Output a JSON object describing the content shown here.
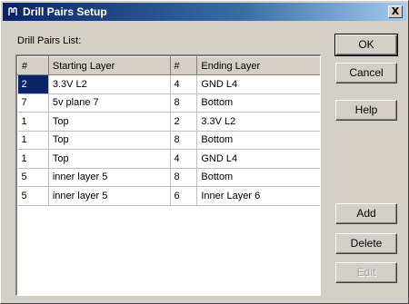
{
  "window": {
    "title": "Drill Pairs Setup",
    "close_label": "X"
  },
  "list": {
    "label": "Drill Pairs List:",
    "columns": [
      "#",
      "Starting Layer",
      "#",
      "Ending Layer"
    ],
    "rows": [
      {
        "start_num": "2",
        "start_layer": "3.3V L2",
        "end_num": "4",
        "end_layer": "GND L4",
        "selected": true
      },
      {
        "start_num": "7",
        "start_layer": "5v plane 7",
        "end_num": "8",
        "end_layer": "Bottom",
        "selected": false
      },
      {
        "start_num": "1",
        "start_layer": "Top",
        "end_num": "2",
        "end_layer": "3.3V L2",
        "selected": false
      },
      {
        "start_num": "1",
        "start_layer": "Top",
        "end_num": "8",
        "end_layer": "Bottom",
        "selected": false
      },
      {
        "start_num": "1",
        "start_layer": "Top",
        "end_num": "4",
        "end_layer": "GND L4",
        "selected": false
      },
      {
        "start_num": "5",
        "start_layer": "inner layer 5",
        "end_num": "8",
        "end_layer": "Bottom",
        "selected": false
      },
      {
        "start_num": "5",
        "start_layer": "inner layer 5",
        "end_num": "6",
        "end_layer": "Inner Layer 6",
        "selected": false
      }
    ]
  },
  "buttons": {
    "ok": "OK",
    "cancel": "Cancel",
    "help": "Help",
    "add": "Add",
    "delete": "Delete",
    "edit": "Edit"
  },
  "icons": {
    "title": "drill-pairs-app-icon",
    "close": "close-icon"
  },
  "colors": {
    "title_bar_start": "#0a246a",
    "title_bar_end": "#a6caf0",
    "selection": "#0a246a",
    "dialog_face": "#d4d0c8"
  }
}
